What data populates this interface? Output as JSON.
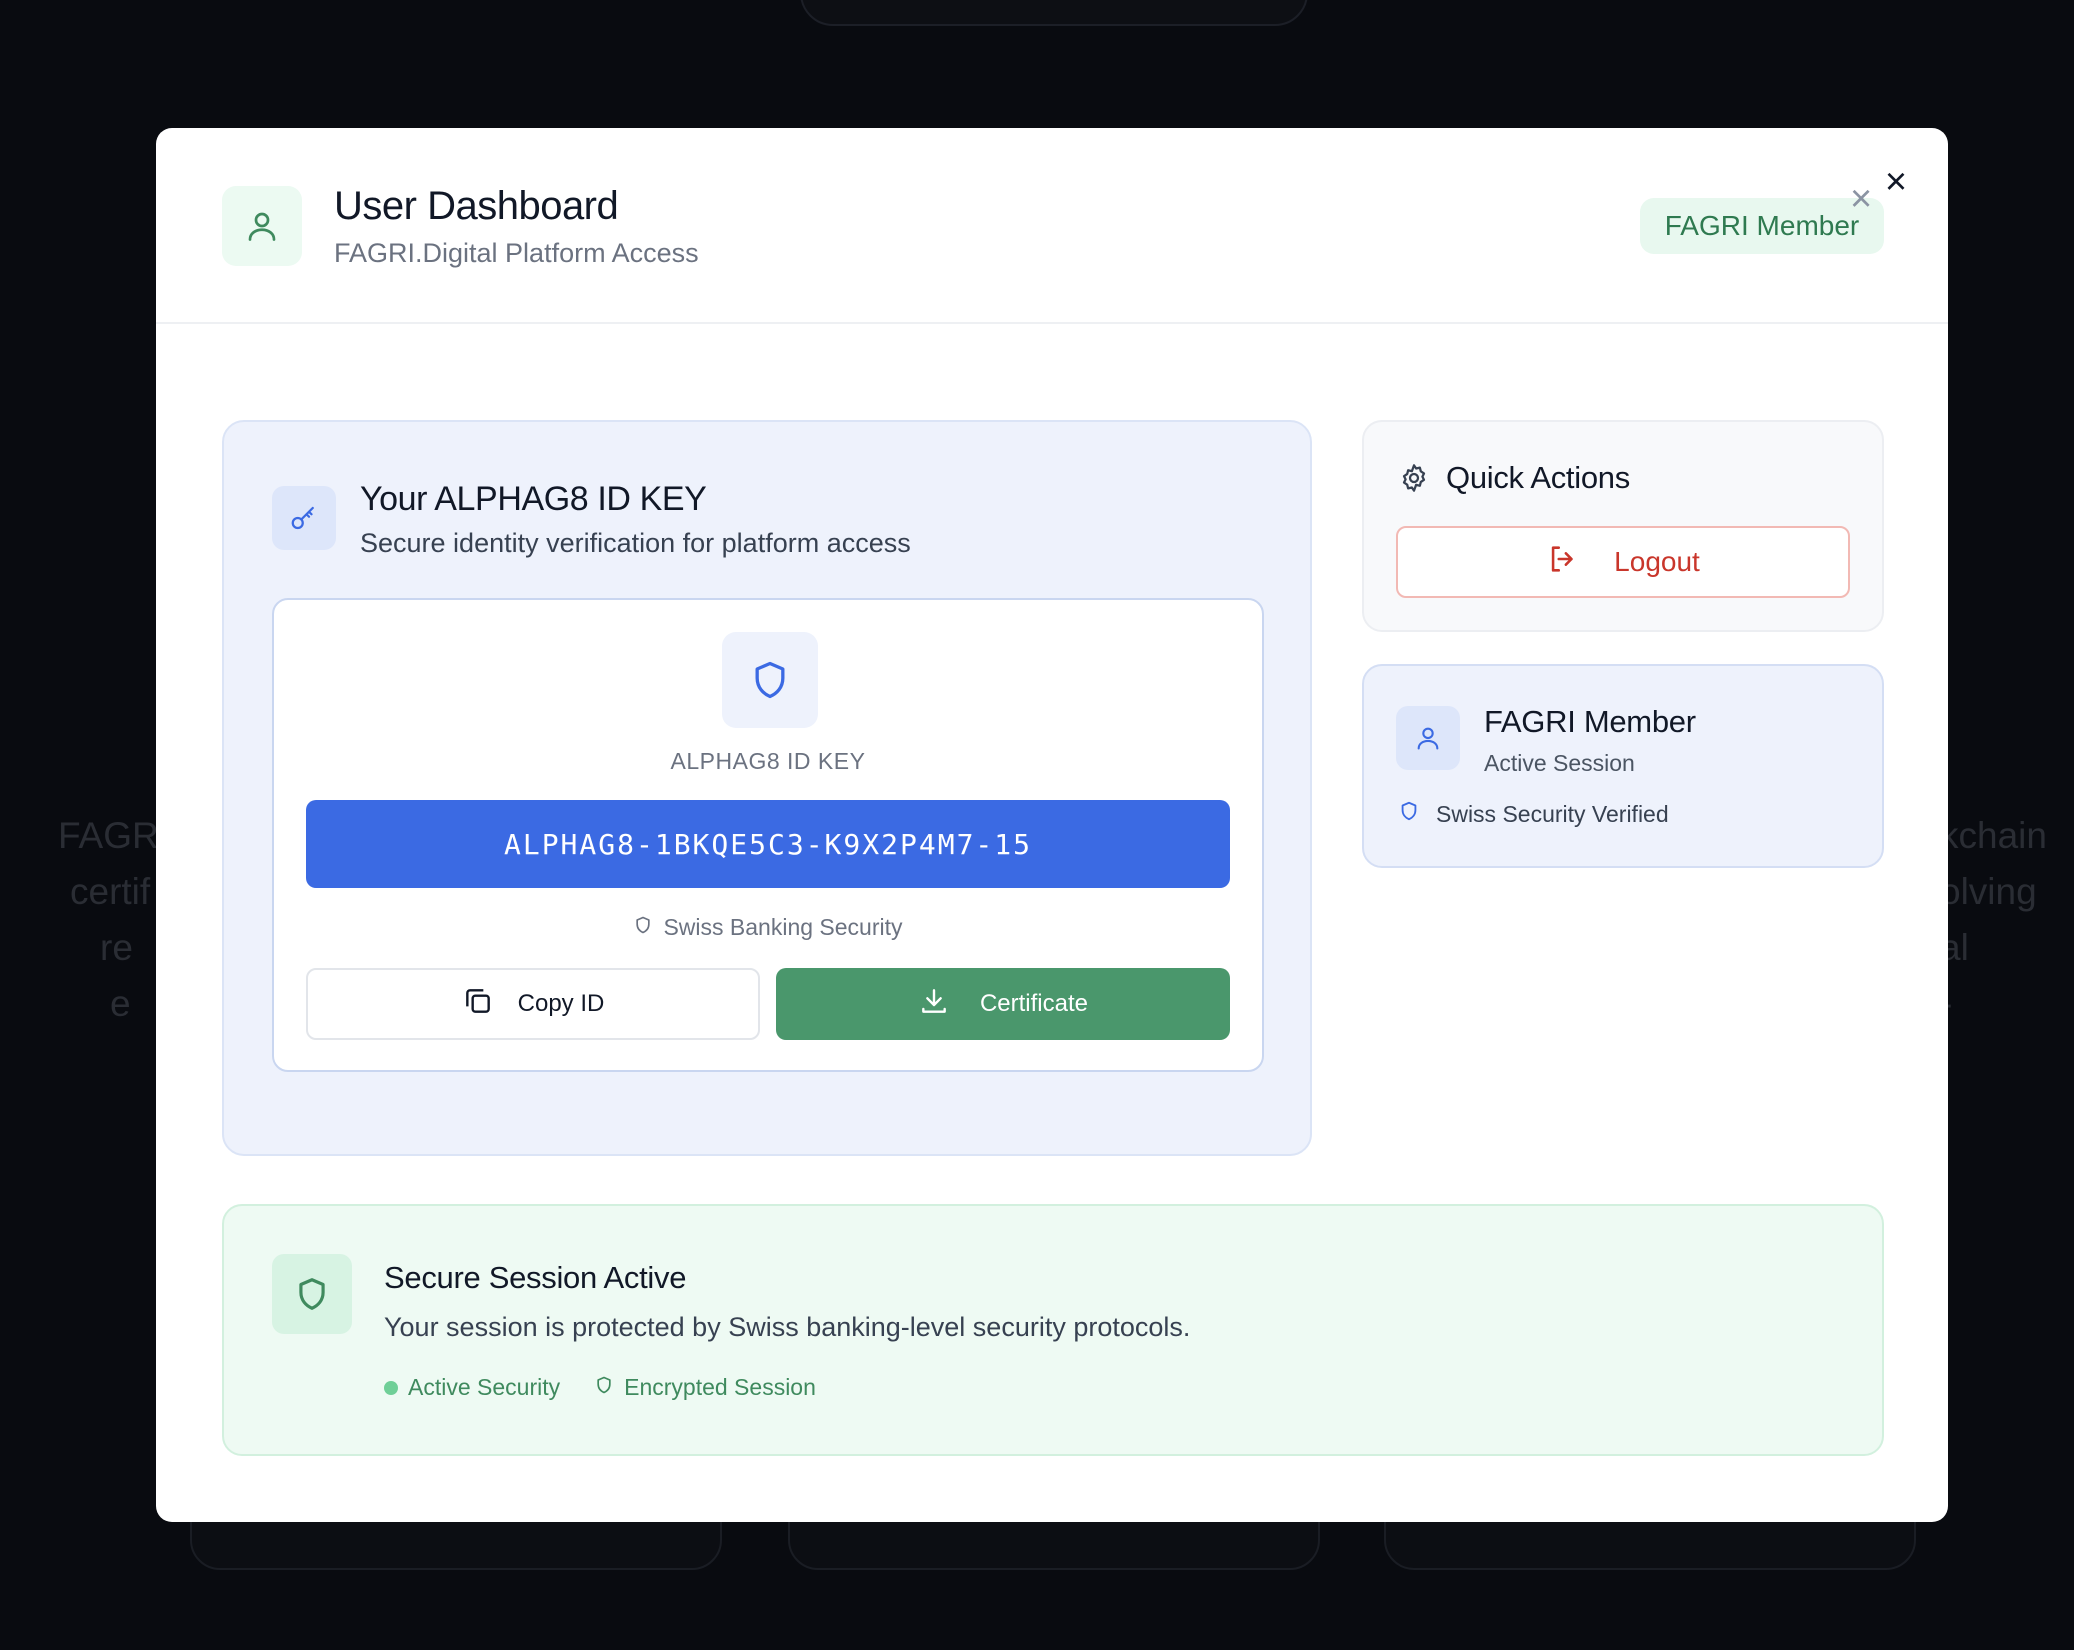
{
  "background": {
    "left_text": [
      "FAGRI",
      "certif",
      "re",
      "e"
    ],
    "right_text": [
      "kchain",
      "olving",
      "al",
      "-"
    ]
  },
  "header": {
    "title": "User Dashboard",
    "subtitle": "FAGRI.Digital Platform Access",
    "badge": "FAGRI Member",
    "close_symbol": "×",
    "badge_close_symbol": "×"
  },
  "id_key": {
    "title": "Your ALPHAG8 ID KEY",
    "subtitle": "Secure identity verification for platform access",
    "label": "ALPHAG8 ID KEY",
    "value": "ALPHAG8-1BKQE5C3-K9X2P4M7-15",
    "security_note": "Swiss Banking Security",
    "copy_label": "Copy ID",
    "certificate_label": "Certificate"
  },
  "quick_actions": {
    "title": "Quick Actions",
    "logout_label": "Logout"
  },
  "member": {
    "title": "FAGRI Member",
    "status": "Active Session",
    "verified": "Swiss Security Verified"
  },
  "session": {
    "title": "Secure Session Active",
    "description": "Your session is protected by Swiss banking-level security protocols.",
    "tags": [
      "Active Security",
      "Encrypted Session"
    ]
  },
  "colors": {
    "primary_blue": "#3b6ae3",
    "success_green": "#4a976c",
    "danger_red": "#c9362b"
  },
  "icons": {
    "header": "user-icon",
    "key": "key-icon",
    "shield": "shield-icon",
    "copy": "copy-icon",
    "download": "download-icon",
    "settings": "gear-icon",
    "logout": "logout-icon",
    "close": "close-icon"
  }
}
